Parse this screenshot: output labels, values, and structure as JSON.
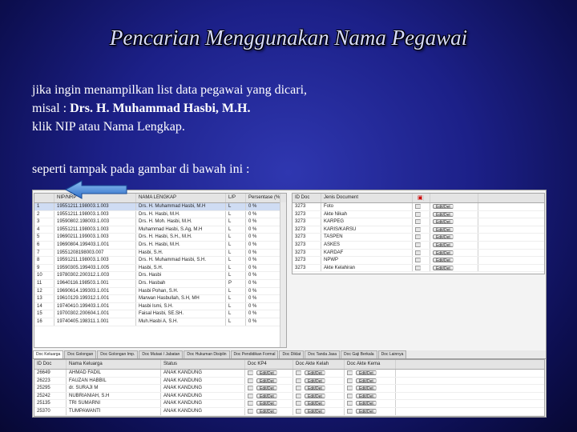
{
  "title": "Pencarian Menggunakan Nama Pegawai",
  "paragraph1": {
    "line1": "jika ingin menampilkan list data pegawai yang dicari,",
    "line2_prefix": "misal : ",
    "line2_name": "Drs. H. Muhammad Hasbi, M.H.",
    "line3": "klik NIP atau Nama Lengkap."
  },
  "paragraph2": "seperti tampak pada gambar di bawah ini :",
  "employee_grid": {
    "columns": [
      "",
      "NIP/NRP",
      "NAMA LENGKAP",
      "L/P",
      "Persentase (%)"
    ],
    "rows": [
      [
        "1",
        "19551211.198003.1.003",
        "Drs. H. Muhammad Hasbi, M.H",
        "L",
        "0 %"
      ],
      [
        "2",
        "19551211.198003.1.003",
        "Drs. H. Hasbi, M.H.",
        "L",
        "0 %"
      ],
      [
        "3",
        "19590802.198003.1.003",
        "Drs. H. Moh. Hasbi, M.H.",
        "L",
        "0 %"
      ],
      [
        "4",
        "19551211.198003.1.003",
        "Muhammad Hasbi, S.Ag, M.H",
        "L",
        "0 %"
      ],
      [
        "5",
        "19690211.199003.1.003",
        "Drs. H. Hasbi, S.H., M.H.",
        "L",
        "0 %"
      ],
      [
        "6",
        "19690804.199403.1.001",
        "Drs. H. Hasbi, M.H.",
        "L",
        "0 %"
      ],
      [
        "7",
        "19551208198003.007",
        "Hasbi, S.H.",
        "L",
        "0 %"
      ],
      [
        "8",
        "19591211.198003.1.003",
        "Drs. H. Muhammad Hasbi, S.H.",
        "L",
        "0 %"
      ],
      [
        "9",
        "19590305.199403.1.005",
        "Hasbi, S.H.",
        "L",
        "0 %"
      ],
      [
        "10",
        "19780302.200312.1.003",
        "Drs. Hasbi",
        "L",
        "0 %"
      ],
      [
        "11",
        "19640116.198503.1.001",
        "Drs. Hasbah",
        "P",
        "0 %"
      ],
      [
        "12",
        "19690614.199303.1.001",
        "Hasbi Pohan, S.H.",
        "L",
        "0 %"
      ],
      [
        "13",
        "19610129.199312.1.001",
        "Marwan Hasbullah, S.H, MH",
        "L",
        "0 %"
      ],
      [
        "14",
        "19740410.199403.1.001",
        "Hasbi Ismi, S.H.",
        "L",
        "0 %"
      ],
      [
        "15",
        "19700302.200604.1.001",
        "Faisal Hasbi, SE.SH.",
        "L",
        "0 %"
      ],
      [
        "16",
        "19740405.198311.1.001",
        "Muh.Hasbi A, S.H.",
        "L",
        "0 %"
      ]
    ]
  },
  "doc_grid": {
    "columns": [
      "ID Doc",
      "Jenis Document",
      ""
    ],
    "button_label": "Edit/Det",
    "rows": [
      [
        "3273",
        "Foto"
      ],
      [
        "3273",
        "Akte Nikah"
      ],
      [
        "3273",
        "KARPEG"
      ],
      [
        "3273",
        "KARIS/KARSU"
      ],
      [
        "3273",
        "TASPEN"
      ],
      [
        "3273",
        "ASKES"
      ],
      [
        "3273",
        "KARDAF"
      ],
      [
        "3273",
        "NPWP"
      ],
      [
        "3273",
        "Akte Kelahiran"
      ]
    ]
  },
  "tabs": [
    "Doc Keluarga",
    "Doc Golongan",
    "Doc Golongan Imp.",
    "Doc Mutasi / Jabatan",
    "Doc Hukuman Disiplin",
    "Doc Pendidikan Formal",
    "Doc Diklat",
    "Doc Tanda Jasa",
    "Doc Gaji Berkala",
    "Doc Lainnya"
  ],
  "family_grid": {
    "columns": [
      "ID Doc",
      "Nama Keluarga",
      "Status",
      "Doc KP4",
      "Doc Akte Kelah",
      "Doc Akte Kema"
    ],
    "button_label": "Edit/Det",
    "rows": [
      [
        "26649",
        "AHMAD FADIL",
        "ANAK KANDUNG"
      ],
      [
        "26223",
        "FAUZAN HABBIL",
        "ANAK KANDUNG"
      ],
      [
        "25295",
        "dr. SURAJI M",
        "ANAK KANDUNG"
      ],
      [
        "25242",
        "NUBRIANIAH, S.H",
        "ANAK KANDUNG"
      ],
      [
        "25135",
        "TRI SUMARNI",
        "ANAK KANDUNG"
      ],
      [
        "25370",
        "TUMPAWANTI",
        "ANAK KANDUNG"
      ]
    ]
  },
  "colors": {
    "accent": "#4a8ed8",
    "selection": "#cfdcf3",
    "background": "#1c2088"
  }
}
